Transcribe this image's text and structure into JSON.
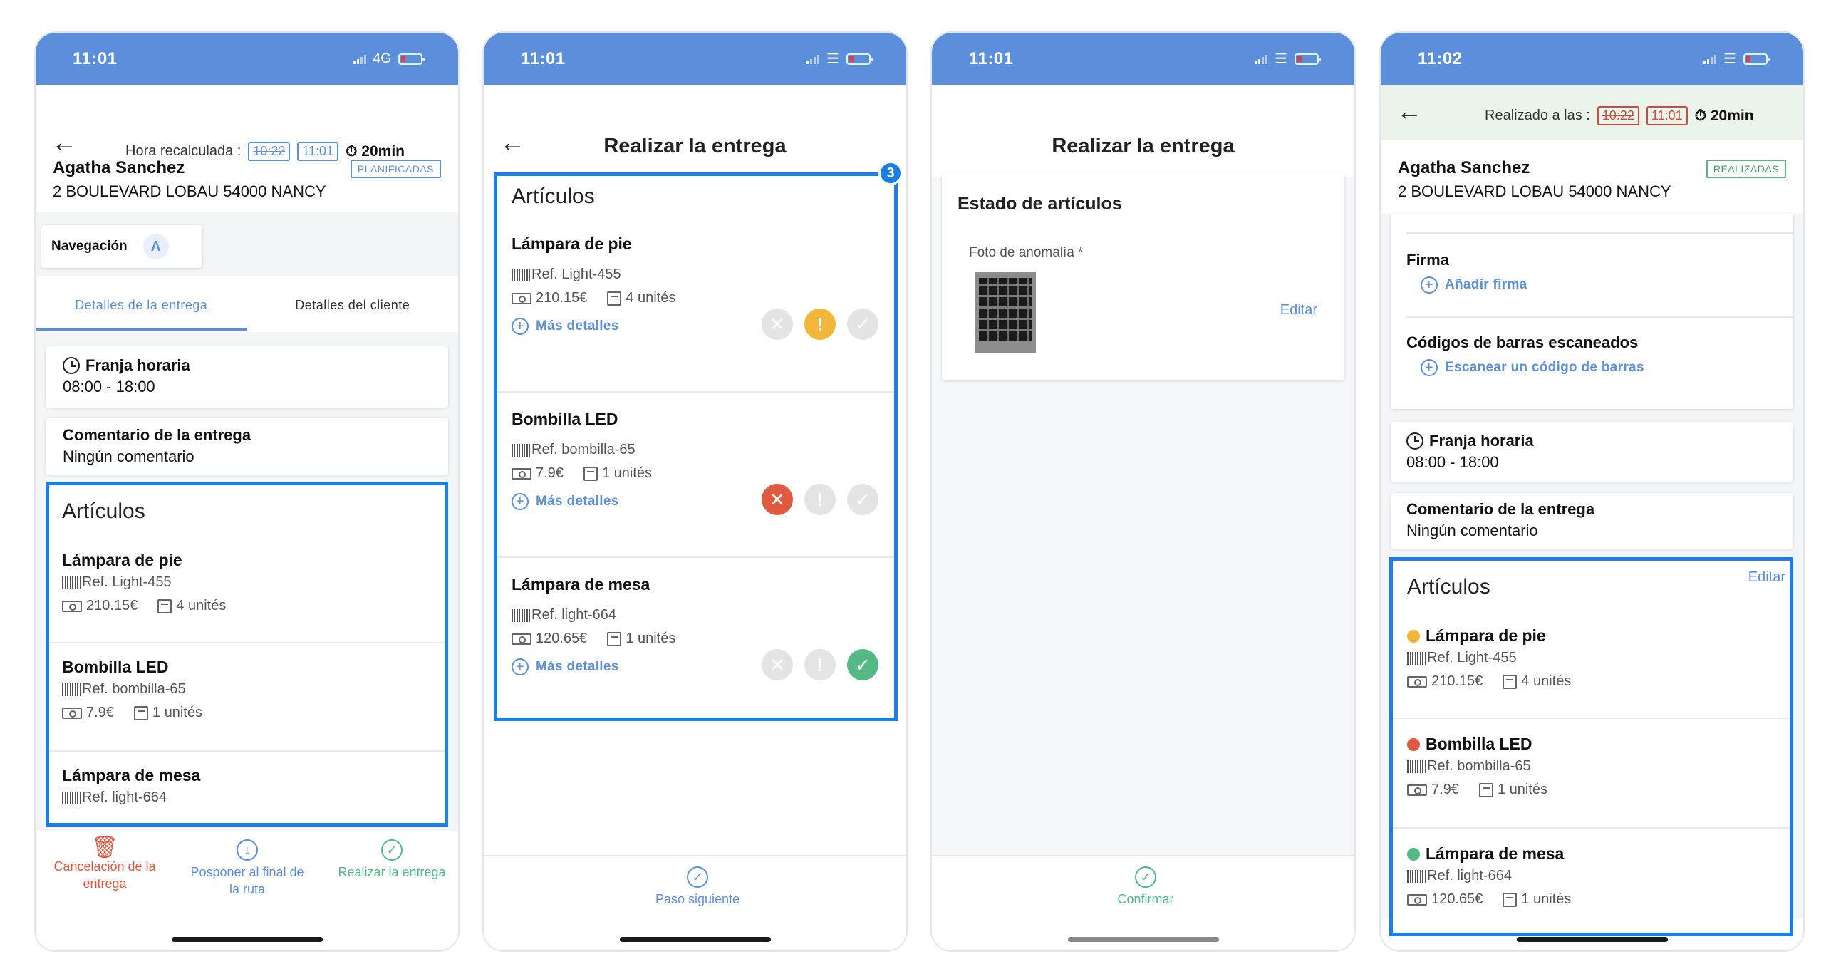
{
  "status": {
    "screen1_time": "11:01",
    "screen1_network": "4G",
    "screen2_time": "11:01",
    "screen3_time": "11:01",
    "screen4_time": "11:02"
  },
  "customer": {
    "name": "Agatha Sanchez",
    "address": "2 BOULEVARD LOBAU 54000 NANCY"
  },
  "screen1": {
    "recalc_label": "Hora recalculada :",
    "old_time": "10:22",
    "new_time": "11:01",
    "duration": "20min",
    "badge": "PLANIFICADAS",
    "nav_label": "Navegación",
    "tabs": [
      "Detalles de la entrega",
      "Detalles del cliente"
    ],
    "slot_label": "Franja horaria",
    "slot_value": "08:00 - 18:00",
    "comment_label": "Comentario de la entrega",
    "comment_value": "Ningún comentario",
    "articles_title": "Artículos",
    "footer": {
      "cancel": "Cancelación de la entrega",
      "postpone": "Posponer al final de la ruta",
      "deliver": "Realizar la entrega"
    }
  },
  "items": [
    {
      "name": "Lámpara de pie",
      "ref": "Ref. Light-455",
      "price": "210.15€",
      "qty": "4 unités"
    },
    {
      "name": "Bombilla LED",
      "ref": "Ref. bombilla-65",
      "price": "7.9€",
      "qty": "1 unités"
    },
    {
      "name": "Lámpara de mesa",
      "ref": "Ref. light-664",
      "price": "120.65€",
      "qty": "1 unités"
    }
  ],
  "screen2": {
    "title": "Realizar la entrega",
    "articles_title": "Artículos",
    "counter": "3",
    "more_details": "Más detalles",
    "next_step": "Paso siguiente"
  },
  "screen3": {
    "title": "Realizar la entrega",
    "card_title": "Estado de artículos",
    "photo_label": "Foto de anomalía *",
    "edit": "Editar",
    "confirm": "Confirmar"
  },
  "screen4": {
    "done_label": "Realizado a las :",
    "old_time": "10:22",
    "new_time": "11:01",
    "duration": "20min",
    "badge": "REALIZADAS",
    "signature_label": "Firma",
    "add_signature": "Añadir firma",
    "barcodes_label": "Códigos de barras escaneados",
    "scan_barcode": "Escanear un código de barras",
    "slot_label": "Franja horaria",
    "slot_value": "08:00 - 18:00",
    "comment_label": "Comentario de la entrega",
    "comment_value": "Ningún comentario",
    "articles_title": "Artículos",
    "edit": "Editar"
  },
  "colors": {
    "header_blue": "#5b8fdc",
    "highlight_blue": "#1a7ee6",
    "done_green_bg": "#eaf4ea",
    "warning": "#f2b73a",
    "error": "#e05a40",
    "success": "#55b986"
  }
}
